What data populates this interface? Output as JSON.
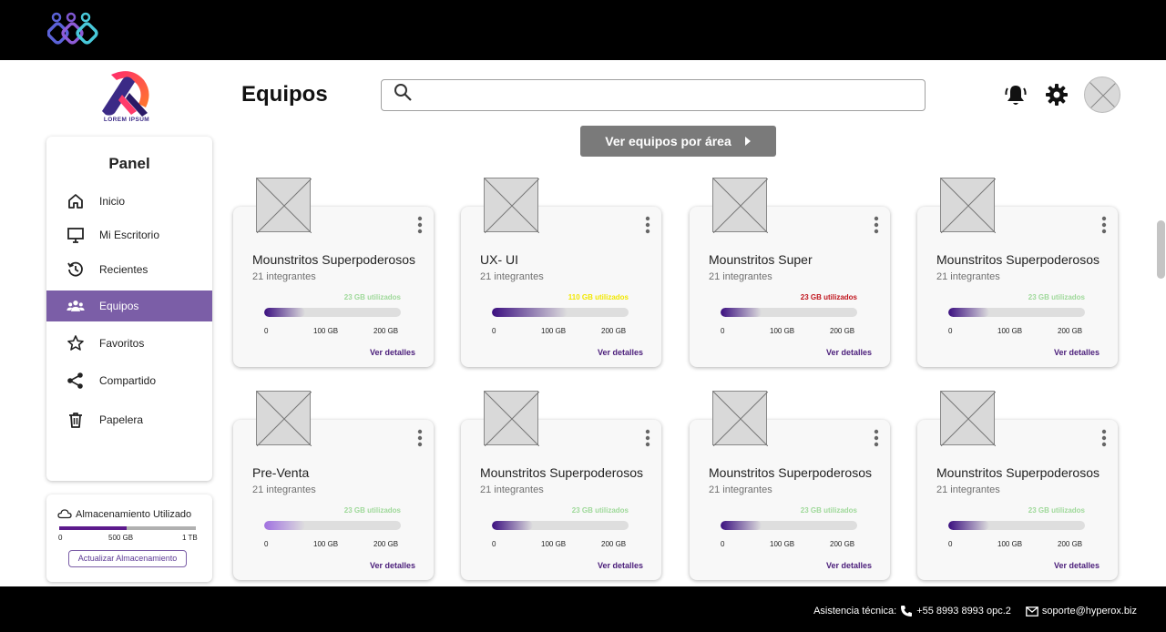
{
  "brand": {
    "logo_text": "LOREM IPSUM"
  },
  "panel": {
    "title": "Panel",
    "items": [
      {
        "label": "Inicio",
        "icon": "home-icon",
        "active": false
      },
      {
        "label": "Mi Escritorio",
        "icon": "monitor-icon",
        "active": false
      },
      {
        "label": "Recientes",
        "icon": "history-icon",
        "active": false
      },
      {
        "label": "Equipos",
        "icon": "users-icon",
        "active": true
      },
      {
        "label": "Favoritos",
        "icon": "star-icon",
        "active": false
      },
      {
        "label": "Compartido",
        "icon": "share-icon",
        "active": false
      },
      {
        "label": "Papelera",
        "icon": "trash-icon",
        "active": false
      }
    ]
  },
  "storage": {
    "title": "Almacenamiento Utilizado",
    "used_fraction": 0.49,
    "ticks": [
      "0",
      "500 GB",
      "1 TB"
    ],
    "button": "Actualizar Almacenamiento"
  },
  "header": {
    "title": "Equipos",
    "search_placeholder": ""
  },
  "area_button": "Ver equipos por área",
  "colors": {
    "accent_purple": "#7b5ea7",
    "deep_purple": "#4a1d7a",
    "used_green": "#9fd99a",
    "used_yellow": "#f2e800",
    "used_red": "#c0141c"
  },
  "cards": [
    {
      "name": "Mounstritos Superpoderosos",
      "members": "21 integrantes",
      "used": "23 GB utilizados",
      "used_color": "#9fd99a",
      "fill": 0.3,
      "fill_gradient": "linear-gradient(90deg,#3b0f80,#dedede)",
      "ticks": [
        "0",
        "100 GB",
        "200 GB"
      ],
      "details": "Ver detalles"
    },
    {
      "name": "UX- UI",
      "members": "21 integrantes",
      "used": "110 GB utilizados",
      "used_color": "#f2e800",
      "fill": 0.55,
      "fill_gradient": "linear-gradient(90deg,#3b0f80,#dedede)",
      "ticks": [
        "0",
        "100 GB",
        "200 GB"
      ],
      "details": "Ver detalles"
    },
    {
      "name": "Mounstritos Super",
      "members": "21 integrantes",
      "used": "23 GB utilizados",
      "used_color": "#c0141c",
      "fill": 0.3,
      "fill_gradient": "linear-gradient(90deg,#3b0f80,#dedede)",
      "ticks": [
        "0",
        "100 GB",
        "200 GB"
      ],
      "details": "Ver detalles"
    },
    {
      "name": "Mounstritos Superpoderosos",
      "members": "21 integrantes",
      "used": "23 GB utilizados",
      "used_color": "#9fd99a",
      "fill": 0.3,
      "fill_gradient": "linear-gradient(90deg,#3b0f80,#dedede)",
      "ticks": [
        "0",
        "100 GB",
        "200 GB"
      ],
      "details": "Ver detalles"
    },
    {
      "name": "Pre-Venta",
      "members": "21 integrantes",
      "used": "23 GB utilizados",
      "used_color": "#9fd99a",
      "fill": 0.3,
      "fill_gradient": "linear-gradient(90deg,#a070e0,#dedede)",
      "ticks": [
        "0",
        "100 GB",
        "200 GB"
      ],
      "details": "Ver detalles"
    },
    {
      "name": "Mounstritos Superpoderosos",
      "members": "21 integrantes",
      "used": "23 GB utilizados",
      "used_color": "#9fd99a",
      "fill": 0.3,
      "fill_gradient": "linear-gradient(90deg,#3b0f80,#dedede)",
      "ticks": [
        "0",
        "100 GB",
        "200 GB"
      ],
      "details": "Ver detalles"
    },
    {
      "name": "Mounstritos Superpoderosos",
      "members": "21 integrantes",
      "used": "23 GB utilizados",
      "used_color": "#9fd99a",
      "fill": 0.3,
      "fill_gradient": "linear-gradient(90deg,#3b0f80,#dedede)",
      "ticks": [
        "0",
        "100 GB",
        "200 GB"
      ],
      "details": "Ver detalles"
    },
    {
      "name": "Mounstritos Superpoderosos",
      "members": "21 integrantes",
      "used": "23 GB utilizados",
      "used_color": "#9fd99a",
      "fill": 0.3,
      "fill_gradient": "linear-gradient(90deg,#3b0f80,#dedede)",
      "ticks": [
        "0",
        "100 GB",
        "200 GB"
      ],
      "details": "Ver detalles"
    }
  ],
  "footer": {
    "label": "Asistencia técnica:",
    "phone": "+55 8993 8993 opc.2",
    "email": "soporte@hyperox.biz"
  }
}
